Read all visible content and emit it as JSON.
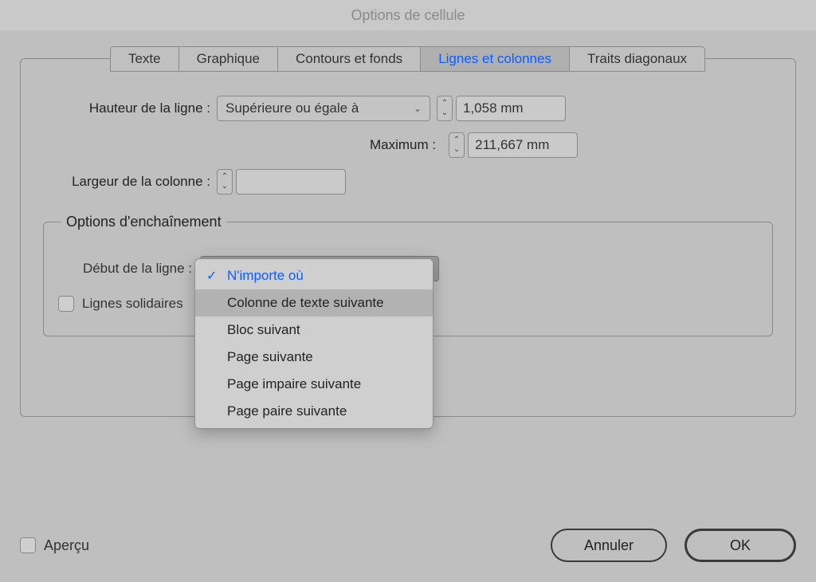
{
  "window": {
    "title": "Options de cellule"
  },
  "tabs": [
    {
      "label": "Texte"
    },
    {
      "label": "Graphique"
    },
    {
      "label": "Contours et fonds"
    },
    {
      "label": "Lignes et colonnes"
    },
    {
      "label": "Traits diagonaux"
    }
  ],
  "fields": {
    "row_height_label": "Hauteur de la ligne :",
    "row_height_mode": "Supérieure ou égale à",
    "row_height_value": "1,058 mm",
    "maximum_label": "Maximum :",
    "maximum_value": "211,667 mm",
    "column_width_label": "Largeur de la colonne :",
    "column_width_value": ""
  },
  "keep": {
    "legend": "Options d'enchaînement",
    "start_label": "Début de la ligne :",
    "start_value": "N'importe où",
    "together_label": "Lignes solidaires"
  },
  "dropdown": {
    "options": [
      "N'importe où",
      "Colonne de texte suivante",
      "Bloc suivant",
      "Page suivante",
      "Page impaire suivante",
      "Page paire suivante"
    ]
  },
  "footer": {
    "preview": "Aperçu",
    "cancel": "Annuler",
    "ok": "OK"
  }
}
